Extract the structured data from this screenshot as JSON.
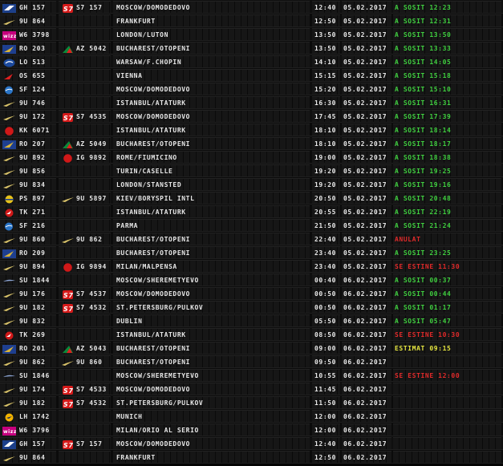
{
  "colors": {
    "status_arrived": "#40d040",
    "status_cancelled": "#e02a2a",
    "status_estimated": "#e6e640",
    "text": "#e8e8e8",
    "background": "#050505"
  },
  "rows": [
    {
      "airline_icon": "georgian-airways-logo-icon",
      "flight": "GH 157",
      "cs_icon": "s7-logo-icon",
      "codeshare": "S7 157",
      "destination": "MOSCOW/DOMODEDOVO",
      "time": "12:40",
      "date": "05.02.2017",
      "status": "A SOSIT 12:23",
      "status_type": "arrived"
    },
    {
      "airline_icon": "tarom-swallow-logo-icon",
      "flight": "9U 864",
      "cs_icon": "",
      "codeshare": "",
      "destination": "FRANKFURT",
      "time": "12:50",
      "date": "05.02.2017",
      "status": "A SOSIT 12:31",
      "status_type": "arrived"
    },
    {
      "airline_icon": "wizz-air-logo-icon",
      "flight": "W6 3798",
      "cs_icon": "",
      "codeshare": "",
      "destination": "LONDON/LUTON",
      "time": "13:50",
      "date": "05.02.2017",
      "status": "A SOSIT 13:50",
      "status_type": "arrived"
    },
    {
      "airline_icon": "tarom-logo-icon",
      "flight": "RO 203",
      "cs_icon": "alitalia-logo-icon",
      "codeshare": "AZ 5042",
      "destination": "BUCHAREST/OTOPENI",
      "time": "13:50",
      "date": "05.02.2017",
      "status": "A SOSIT 13:33",
      "status_type": "arrived"
    },
    {
      "airline_icon": "lot-logo-icon",
      "flight": "LO 513",
      "cs_icon": "",
      "codeshare": "",
      "destination": "WARSAW/F.CHOPIN",
      "time": "14:10",
      "date": "05.02.2017",
      "status": "A SOSIT 14:05",
      "status_type": "arrived"
    },
    {
      "airline_icon": "austrian-logo-icon",
      "flight": "OS 655",
      "cs_icon": "",
      "codeshare": "",
      "destination": "VIENNA",
      "time": "15:15",
      "date": "05.02.2017",
      "status": "A SOSIT 15:18",
      "status_type": "arrived"
    },
    {
      "airline_icon": "s7-globe-logo-icon",
      "flight": "SF 124",
      "cs_icon": "",
      "codeshare": "",
      "destination": "MOSCOW/DOMODEDOVO",
      "time": "15:20",
      "date": "05.02.2017",
      "status": "A SOSIT 15:10",
      "status_type": "arrived"
    },
    {
      "airline_icon": "tarom-swallow-logo-icon",
      "flight": "9U 746",
      "cs_icon": "",
      "codeshare": "",
      "destination": "ISTANBUL/ATATURK",
      "time": "16:30",
      "date": "05.02.2017",
      "status": "A SOSIT 16:31",
      "status_type": "arrived"
    },
    {
      "airline_icon": "tarom-swallow-logo-icon",
      "flight": "9U 172",
      "cs_icon": "s7-logo-icon",
      "codeshare": "S7 4535",
      "destination": "MOSCOW/DOMODEDOVO",
      "time": "17:45",
      "date": "05.02.2017",
      "status": "A SOSIT 17:39",
      "status_type": "arrived"
    },
    {
      "airline_icon": "red-circle-logo-icon",
      "flight": "KK 6071",
      "cs_icon": "",
      "codeshare": "",
      "destination": "ISTANBUL/ATATURK",
      "time": "18:10",
      "date": "05.02.2017",
      "status": "A SOSIT 18:14",
      "status_type": "arrived"
    },
    {
      "airline_icon": "tarom-logo-icon",
      "flight": "RO 207",
      "cs_icon": "alitalia-logo-icon",
      "codeshare": "AZ 5049",
      "destination": "BUCHAREST/OTOPENI",
      "time": "18:10",
      "date": "05.02.2017",
      "status": "A SOSIT 18:17",
      "status_type": "arrived"
    },
    {
      "airline_icon": "tarom-swallow-logo-icon",
      "flight": "9U 892",
      "cs_icon": "red-circle-logo-icon",
      "codeshare": "IG 9892",
      "destination": "ROME/FIUMICINO",
      "time": "19:00",
      "date": "05.02.2017",
      "status": "A SOSIT 18:38",
      "status_type": "arrived"
    },
    {
      "airline_icon": "tarom-swallow-logo-icon",
      "flight": "9U 856",
      "cs_icon": "",
      "codeshare": "",
      "destination": "TURIN/CASELLE",
      "time": "19:20",
      "date": "05.02.2017",
      "status": "A SOSIT 19:25",
      "status_type": "arrived"
    },
    {
      "airline_icon": "tarom-swallow-logo-icon",
      "flight": "9U 834",
      "cs_icon": "",
      "codeshare": "",
      "destination": "LONDON/STANSTED",
      "time": "19:20",
      "date": "05.02.2017",
      "status": "A SOSIT 19:16",
      "status_type": "arrived"
    },
    {
      "airline_icon": "uia-logo-icon",
      "flight": "PS 897",
      "cs_icon": "tarom-swallow-logo-icon",
      "codeshare": "9U 5897",
      "destination": "KIEV/BORYSPIL INTL",
      "time": "20:50",
      "date": "05.02.2017",
      "status": "A SOSIT 20:48",
      "status_type": "arrived"
    },
    {
      "airline_icon": "turkish-logo-icon",
      "flight": "TK 271",
      "cs_icon": "",
      "codeshare": "",
      "destination": "ISTANBUL/ATATURK",
      "time": "20:55",
      "date": "05.02.2017",
      "status": "A SOSIT 22:19",
      "status_type": "arrived"
    },
    {
      "airline_icon": "s7-globe-logo-icon",
      "flight": "SF 216",
      "cs_icon": "",
      "codeshare": "",
      "destination": "PARMA",
      "time": "21:50",
      "date": "05.02.2017",
      "status": "A SOSIT 21:24",
      "status_type": "arrived"
    },
    {
      "airline_icon": "tarom-swallow-logo-icon",
      "flight": "9U 860",
      "cs_icon": "tarom-swallow-logo-icon",
      "codeshare": "9U 862",
      "destination": "BUCHAREST/OTOPENI",
      "time": "22:40",
      "date": "05.02.2017",
      "status": "ANULAT",
      "status_type": "cancelled"
    },
    {
      "airline_icon": "tarom-logo-icon",
      "flight": "RO 209",
      "cs_icon": "",
      "codeshare": "",
      "destination": "BUCHAREST/OTOPENI",
      "time": "23:40",
      "date": "05.02.2017",
      "status": "A SOSIT 23:25",
      "status_type": "arrived"
    },
    {
      "airline_icon": "tarom-swallow-logo-icon",
      "flight": "9U 894",
      "cs_icon": "red-circle-logo-icon",
      "codeshare": "IG 9894",
      "destination": "MILAN/MALPENSA",
      "time": "23:40",
      "date": "05.02.2017",
      "status": "SE ESTINE 11:30",
      "status_type": "cancelled"
    },
    {
      "airline_icon": "aeroflot-logo-icon",
      "flight": "SU 1844",
      "cs_icon": "",
      "codeshare": "",
      "destination": "MOSCOW/SHEREMETYEVO",
      "time": "00:40",
      "date": "06.02.2017",
      "status": "A SOSIT 00:37",
      "status_type": "arrived"
    },
    {
      "airline_icon": "tarom-swallow-logo-icon",
      "flight": "9U 176",
      "cs_icon": "s7-logo-icon",
      "codeshare": "S7 4537",
      "destination": "MOSCOW/DOMODEDOVO",
      "time": "00:50",
      "date": "06.02.2017",
      "status": "A SOSIT 00:44",
      "status_type": "arrived"
    },
    {
      "airline_icon": "tarom-swallow-logo-icon",
      "flight": "9U 182",
      "cs_icon": "s7-logo-icon",
      "codeshare": "S7 4532",
      "destination": "ST.PETERSBURG/PULKOV",
      "time": "00:50",
      "date": "06.02.2017",
      "status": "A SOSIT 01:17",
      "status_type": "arrived"
    },
    {
      "airline_icon": "tarom-swallow-logo-icon",
      "flight": "9U 832",
      "cs_icon": "",
      "codeshare": "",
      "destination": "DUBLIN",
      "time": "05:50",
      "date": "06.02.2017",
      "status": "A SOSIT 05:47",
      "status_type": "arrived"
    },
    {
      "airline_icon": "turkish-logo-icon",
      "flight": "TK 269",
      "cs_icon": "",
      "codeshare": "",
      "destination": "ISTANBUL/ATATURK",
      "time": "08:50",
      "date": "06.02.2017",
      "status": "SE ESTINE 10:30",
      "status_type": "cancelled"
    },
    {
      "airline_icon": "tarom-logo-icon",
      "flight": "RO 201",
      "cs_icon": "alitalia-logo-icon",
      "codeshare": "AZ 5043",
      "destination": "BUCHAREST/OTOPENI",
      "time": "09:00",
      "date": "06.02.2017",
      "status": "ESTIMAT 09:15",
      "status_type": "estimated"
    },
    {
      "airline_icon": "tarom-swallow-logo-icon",
      "flight": "9U 862",
      "cs_icon": "tarom-swallow-logo-icon",
      "codeshare": "9U 860",
      "destination": "BUCHAREST/OTOPENI",
      "time": "09:50",
      "date": "06.02.2017",
      "status": "",
      "status_type": "none"
    },
    {
      "airline_icon": "aeroflot-logo-icon",
      "flight": "SU 1846",
      "cs_icon": "",
      "codeshare": "",
      "destination": "MOSCOW/SHEREMETYEVO",
      "time": "10:55",
      "date": "06.02.2017",
      "status": "SE ESTINE 12:00",
      "status_type": "cancelled"
    },
    {
      "airline_icon": "tarom-swallow-logo-icon",
      "flight": "9U 174",
      "cs_icon": "s7-logo-icon",
      "codeshare": "S7 4533",
      "destination": "MOSCOW/DOMODEDOVO",
      "time": "11:45",
      "date": "06.02.2017",
      "status": "",
      "status_type": "none"
    },
    {
      "airline_icon": "tarom-swallow-logo-icon",
      "flight": "9U 182",
      "cs_icon": "s7-logo-icon",
      "codeshare": "S7 4532",
      "destination": "ST.PETERSBURG/PULKOV",
      "time": "11:50",
      "date": "06.02.2017",
      "status": "",
      "status_type": "none"
    },
    {
      "airline_icon": "lufthansa-logo-icon",
      "flight": "LH 1742",
      "cs_icon": "",
      "codeshare": "",
      "destination": "MUNICH",
      "time": "12:00",
      "date": "06.02.2017",
      "status": "",
      "status_type": "none"
    },
    {
      "airline_icon": "wizz-air-logo-icon",
      "flight": "W6 3796",
      "cs_icon": "",
      "codeshare": "",
      "destination": "MILAN/ORIO AL SERIO",
      "time": "12:00",
      "date": "06.02.2017",
      "status": "",
      "status_type": "none"
    },
    {
      "airline_icon": "georgian-airways-logo-icon",
      "flight": "GH 157",
      "cs_icon": "s7-logo-icon",
      "codeshare": "S7 157",
      "destination": "MOSCOW/DOMODEDOVO",
      "time": "12:40",
      "date": "06.02.2017",
      "status": "",
      "status_type": "none"
    },
    {
      "airline_icon": "tarom-swallow-logo-icon",
      "flight": "9U 864",
      "cs_icon": "",
      "codeshare": "",
      "destination": "FRANKFURT",
      "time": "12:50",
      "date": "06.02.2017",
      "status": "",
      "status_type": "none"
    }
  ]
}
